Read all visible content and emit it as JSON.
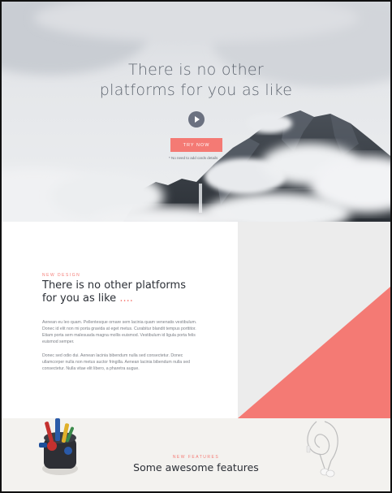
{
  "hero": {
    "title_line1": "There is no other",
    "title_line2": "platforms for you as like",
    "cta_label": "TRY NOW",
    "note": "* No need to add cards details"
  },
  "design": {
    "eyebrow": "NEW DESIGN",
    "title_line1": "There is no other platforms",
    "title_line2": "for you as like",
    "title_dots": "....",
    "paragraph1": "Aenean eu leo quam. Pellentesque ornare sem lacinia quam venenatis vestibulum. Donec id elit non mi porta gravida at eget metus. Curabitur blandit tempus porttitor. Etiam porta sem malesuada magna mollis euismod. Vestibulum id ligula porta felis euismod semper.",
    "paragraph2": "Donec sed odio dui. Aenean lacinia bibendum nulla sed consectetur. Donec ullamcorper nulla non metus auctor fringilla. Aenean lacinia bibendum nulla sed consectetur. Nulla vitae elit libero, a pharetra augue."
  },
  "features": {
    "eyebrow": "NEW FEATURES",
    "title": "Some awesome features"
  },
  "colors": {
    "accent": "#f47a74",
    "panel_grey": "#ececec",
    "features_bg": "#f3f2ef"
  },
  "icons": {
    "play": "play-icon"
  }
}
